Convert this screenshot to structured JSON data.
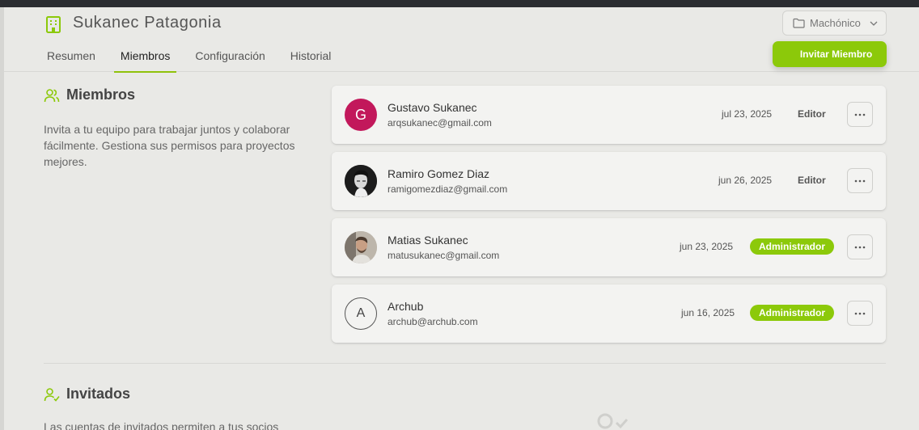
{
  "header": {
    "org_icon": "building-icon",
    "org_name": "Sukanec Patagonia",
    "project_selector": {
      "icon": "folder-icon",
      "value": "Machónico",
      "chevron": "chevron-down-icon"
    },
    "tabs": [
      {
        "label": "Resumen",
        "active": false
      },
      {
        "label": "Miembros",
        "active": true
      },
      {
        "label": "Configuración",
        "active": false
      },
      {
        "label": "Historial",
        "active": false
      }
    ],
    "invite_button": "Invitar Miembro"
  },
  "members_section": {
    "icon": "users-icon",
    "title": "Miembros",
    "description": "Invita a tu equipo para trabajar juntos y colaborar fácilmente. Gestiona sus permisos para proyectos mejores.",
    "members": [
      {
        "name": "Gustavo Sukanec",
        "email": "arqsukanec@gmail.com",
        "date": "jul 23, 2025",
        "role": "Editor",
        "avatar_letter": "G"
      },
      {
        "name": "Ramiro Gomez Diaz",
        "email": "ramigomezdiaz@gmail.com",
        "date": "jun 26, 2025",
        "role": "Editor",
        "avatar_letter": ""
      },
      {
        "name": "Matias Sukanec",
        "email": "matusukanec@gmail.com",
        "date": "jun 23, 2025",
        "role": "Administrador",
        "avatar_letter": ""
      },
      {
        "name": "Archub",
        "email": "archub@archub.com",
        "date": "jun 16, 2025",
        "role": "Administrador",
        "avatar_letter": "A"
      }
    ]
  },
  "guests_section": {
    "icon": "user-check-icon",
    "title": "Invitados",
    "description": "Las cuentas de invitados permiten a tus socios"
  },
  "colors": {
    "accent": "#8cc90a",
    "avatar_g": "#c2185b",
    "background": "#e9e9e6"
  }
}
